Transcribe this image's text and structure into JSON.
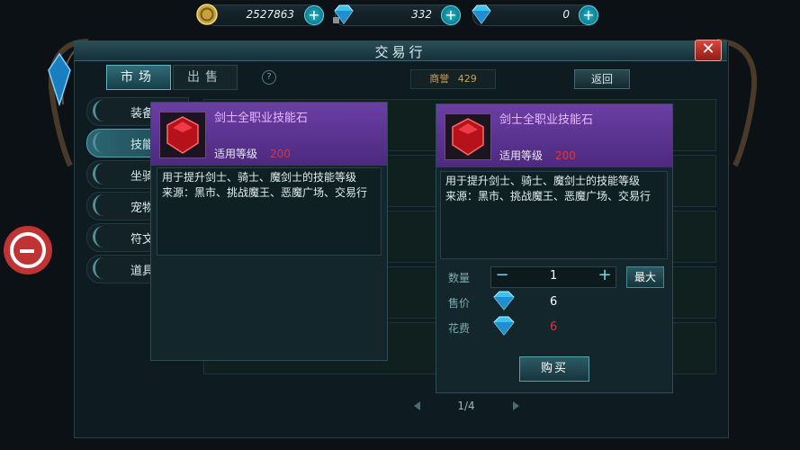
{
  "currency": {
    "gold": "2527863",
    "diamond_bound": "332",
    "diamond": "0",
    "add_label": "+"
  },
  "window": {
    "title": "交易行",
    "close_label": "✕"
  },
  "tabs": [
    {
      "label": "市场",
      "active": true
    },
    {
      "label": "出售",
      "active": false
    }
  ],
  "help_label": "?",
  "reputation": {
    "label": "商誉",
    "value": "429"
  },
  "back_label": "返回",
  "categories": [
    {
      "label": "装备",
      "active": false
    },
    {
      "label": "技能",
      "active": true
    },
    {
      "label": "坐骑",
      "active": false
    },
    {
      "label": "宠物",
      "active": false
    },
    {
      "label": "符文",
      "active": false
    },
    {
      "label": "道具",
      "active": false
    }
  ],
  "pager": {
    "text": "1/4"
  },
  "left_card": {
    "name": "剑士全职业技能石",
    "level_label": "适用等级",
    "level_value": "200",
    "description": "用于提升剑士、骑士、魔剑士的技能等级\n来源：黑市、挑战魔王、恶魔广场、交易行"
  },
  "right_card": {
    "name": "剑士全职业技能石",
    "level_label": "适用等级",
    "level_value": "200",
    "description": "用于提升剑士、骑士、魔剑士的技能等级\n来源：黑市、挑战魔王、恶魔广场、交易行",
    "quantity_label": "数量",
    "quantity": "1",
    "minus_label": "−",
    "plus_label": "+",
    "max_label": "最大",
    "price_label": "售价",
    "price": "6",
    "cost_label": "花费",
    "cost": "6",
    "buy_label": "购买"
  },
  "colors": {
    "accent": "#5fd8e6",
    "card_purple": "#6b3ea5",
    "level_red": "#e0343a",
    "cost_red": "#e0343a"
  },
  "icons": {
    "gold": "gold-coin-icon",
    "diamond": "blue-diamond-icon",
    "gem": "red-gem-icon"
  }
}
